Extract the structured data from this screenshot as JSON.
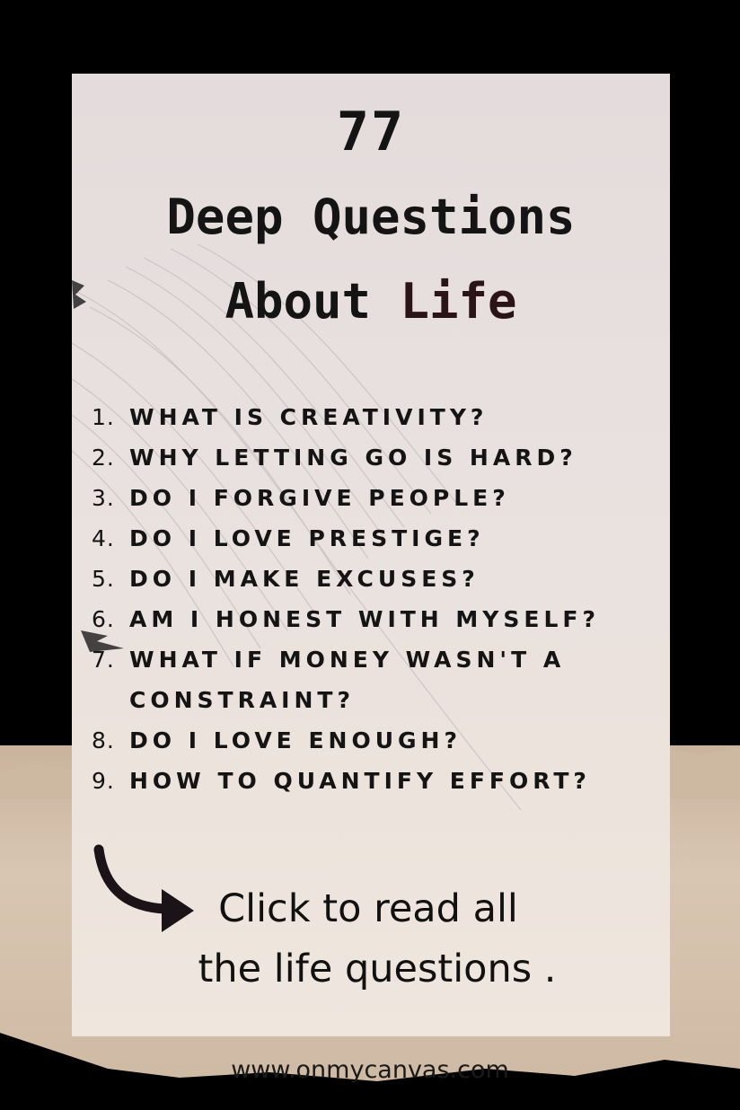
{
  "pin": {
    "title_number": "77",
    "title_line1": "Deep Questions",
    "title_line2_prefix": "About ",
    "title_line2_accent": "Life",
    "questions": [
      {
        "num": "1.",
        "text": "What is creativity?"
      },
      {
        "num": "2.",
        "text": "Why letting go is hard?"
      },
      {
        "num": "3.",
        "text": "Do I forgive people?"
      },
      {
        "num": "4.",
        "text": "Do I love prestige?"
      },
      {
        "num": "5.",
        "text": "Do I make excuses?"
      },
      {
        "num": "6.",
        "text": "Am I honest with myself?"
      },
      {
        "num": "7.",
        "text": "What if money wasn't a constraint?"
      },
      {
        "num": "8.",
        "text": "Do I love enough?"
      },
      {
        "num": "9.",
        "text": "How to quantify effort?"
      }
    ],
    "cta_line1": "Click to read all",
    "cta_line2": "the life questions .",
    "arrow_icon": "curved-arrow-right-icon",
    "footer_url": "www.onmycanvas.com"
  },
  "colors": {
    "card": "#e9e1df",
    "text": "#141414",
    "accent": "#2a1418",
    "beige": "#d2bda7",
    "background": "#000000"
  }
}
